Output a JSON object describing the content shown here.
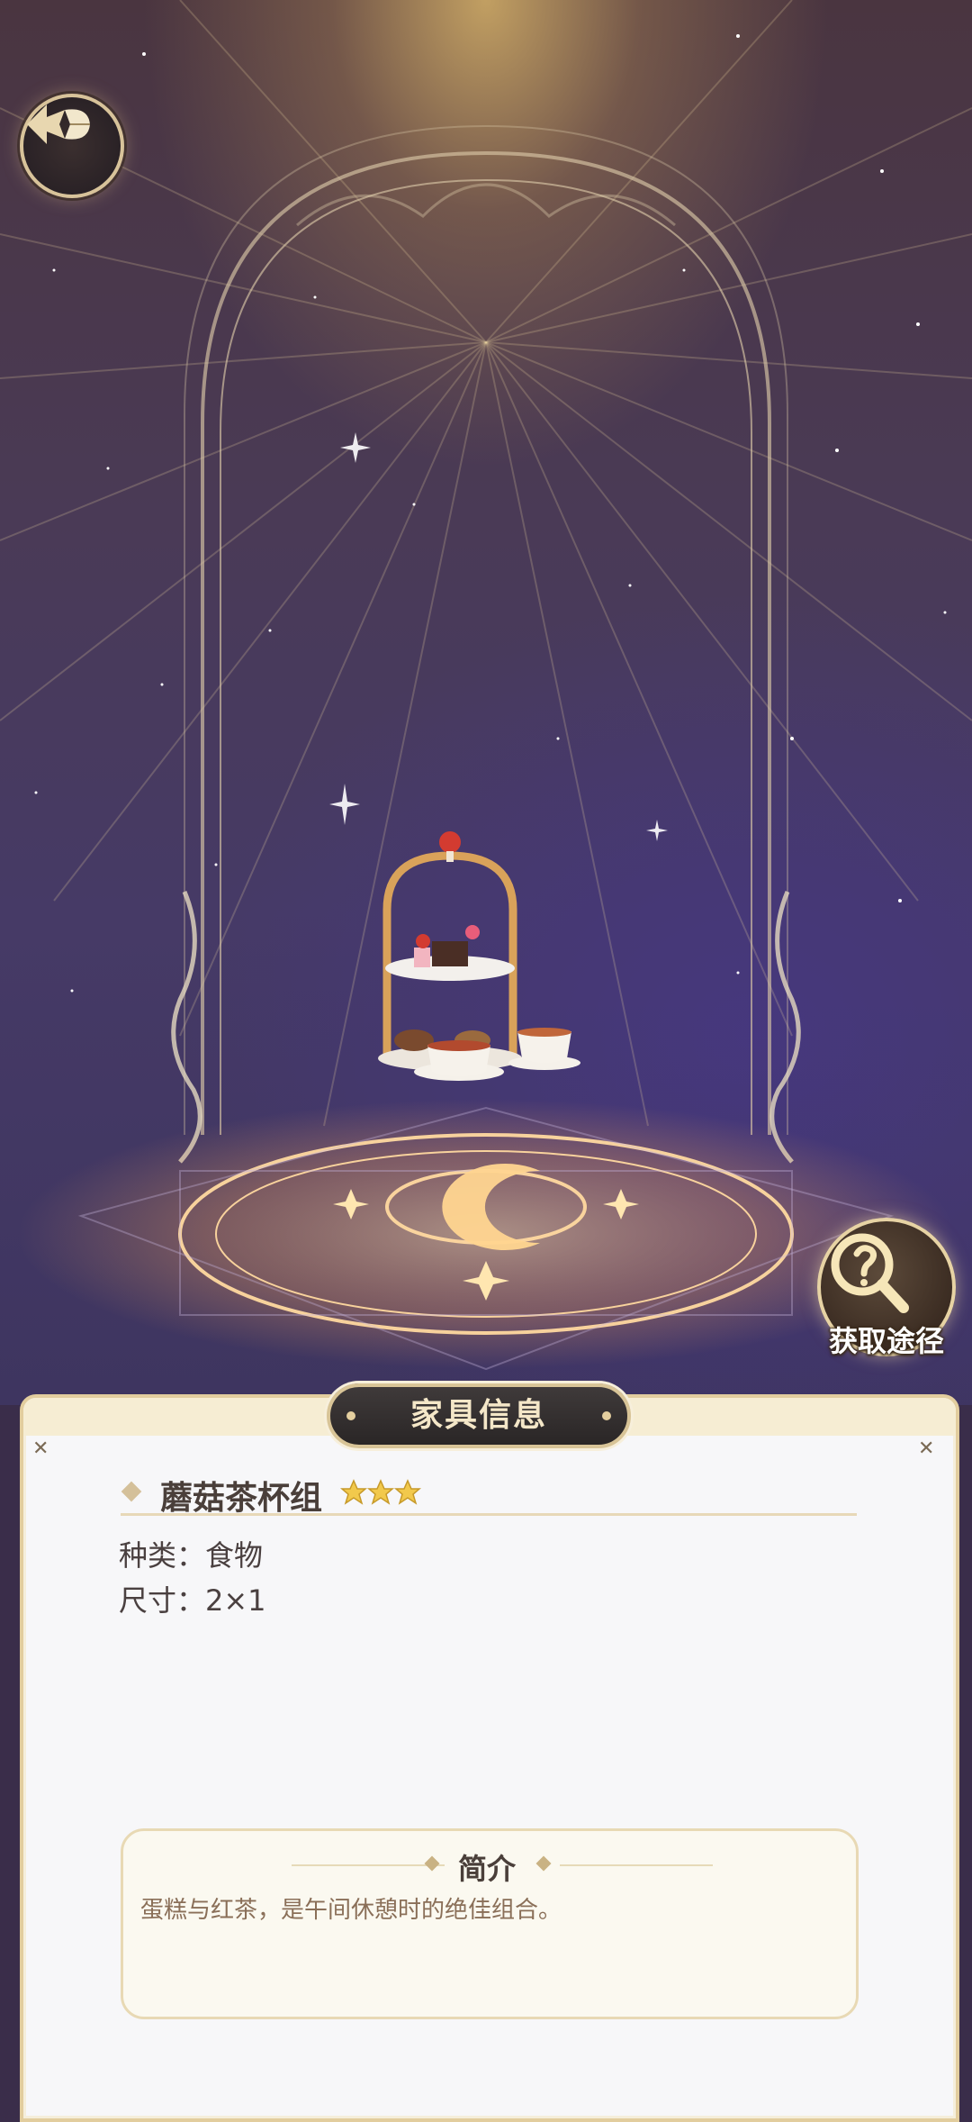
{
  "header": {
    "back_icon": "back-arrow-icon"
  },
  "scene": {
    "item_preview": "mushroom-tea-set",
    "source_button": {
      "label": "获取途径",
      "icon": "question-magnifier-icon"
    }
  },
  "panel": {
    "title": "家具信息",
    "item": {
      "name": "蘑菇茶杯组",
      "rarity_stars": 3,
      "rarity_max": 3,
      "type_label": "种类：食物",
      "size_label": "尺寸：2×1"
    },
    "intro": {
      "title": "简介",
      "text": "蛋糕与红茶，是午间休憩时的绝佳组合。"
    }
  },
  "colors": {
    "gold": "#e2cd9e",
    "panel_bg": "#f7f7f9",
    "text_dark": "#4a3f3a",
    "intro_text": "#8a6f58"
  }
}
